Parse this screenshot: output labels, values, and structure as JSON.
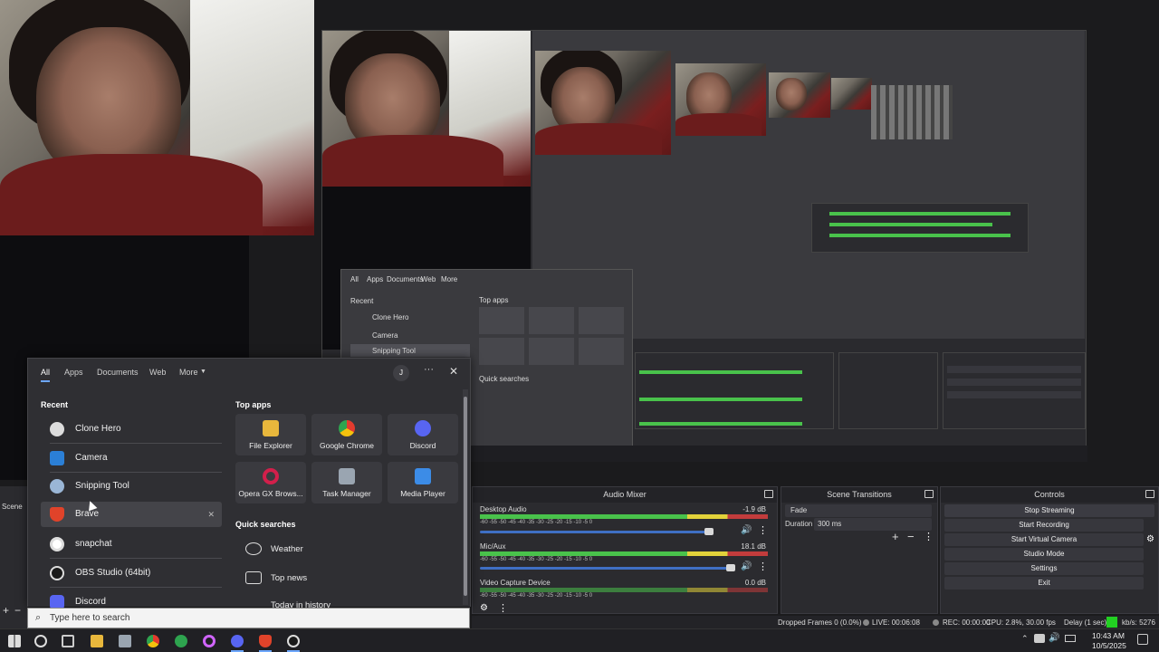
{
  "window": {
    "title": ""
  },
  "start_menu": {
    "tabs": [
      "All",
      "Apps",
      "Documents",
      "Web",
      "More"
    ],
    "user_initial": "J",
    "recent_heading": "Recent",
    "recent": [
      {
        "label": "Clone Hero",
        "icon": "clone-hero-icon"
      },
      {
        "label": "Camera",
        "icon": "camera-icon"
      },
      {
        "label": "Snipping Tool",
        "icon": "snipping-tool-icon"
      },
      {
        "label": "Brave",
        "icon": "brave-icon"
      },
      {
        "label": "snapchat",
        "icon": "search-icon"
      },
      {
        "label": "OBS Studio (64bit)",
        "icon": "obs-icon"
      },
      {
        "label": "Discord",
        "icon": "discord-icon"
      }
    ],
    "top_apps_heading": "Top apps",
    "top_apps": [
      {
        "label": "File Explorer",
        "icon": "folder-icon",
        "color": "#e8b73c"
      },
      {
        "label": "Google Chrome",
        "icon": "chrome-icon",
        "color": "#3c8ce7"
      },
      {
        "label": "Discord",
        "icon": "discord-icon",
        "color": "#5865f2"
      },
      {
        "label": "Opera GX Brows...",
        "icon": "opera-gx-icon",
        "color": "#d21f4b"
      },
      {
        "label": "Task Manager",
        "icon": "task-manager-icon",
        "color": "#9aa5b1"
      },
      {
        "label": "Media Player",
        "icon": "media-player-icon",
        "color": "#3c8ce7"
      }
    ],
    "quick_searches_heading": "Quick searches",
    "quick_searches": [
      "Weather",
      "Top news",
      "Today in history"
    ],
    "search_placeholder": "Type here to search"
  },
  "obs": {
    "scene_label": "Scene",
    "audio_mixer": {
      "title": "Audio Mixer",
      "ticks": "-60   -55   -50   -45   -40   -35   -30   -25   -20   -15   -10   -5   0",
      "channels": [
        {
          "name": "Desktop Audio",
          "db": "-1.9 dB"
        },
        {
          "name": "Mic/Aux",
          "db": "18.1 dB"
        },
        {
          "name": "Video Capture Device",
          "db": "0.0 dB"
        }
      ]
    },
    "scene_transitions": {
      "title": "Scene Transitions",
      "transition": "Fade",
      "duration_label": "Duration",
      "duration": "300 ms"
    },
    "controls": {
      "title": "Controls",
      "buttons": [
        "Stop Streaming",
        "Start Recording",
        "Start Virtual Camera",
        "Studio Mode",
        "Settings",
        "Exit"
      ]
    },
    "status": {
      "dropped": "Dropped Frames 0 (0.0%)",
      "live": "LIVE: 00:06:08",
      "rec": "REC: 00:00:00",
      "cpu": "CPU: 2.8%, 30.00 fps",
      "delay": "Delay (1 sec)",
      "kbps": "kb/s: 5276"
    }
  },
  "clock": {
    "time": "10:43 AM",
    "date": "10/5/2025"
  },
  "colors": {
    "accent": "#3f6fc4",
    "meter_green": "#49c24b",
    "meter_yellow": "#e2d23a",
    "meter_red": "#c23c3c",
    "live_square": "#22d022"
  }
}
